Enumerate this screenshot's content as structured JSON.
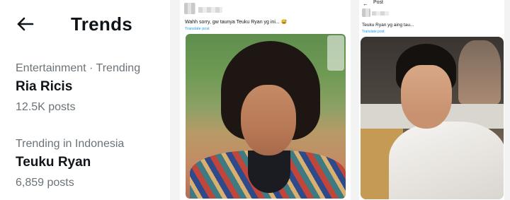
{
  "trends_panel": {
    "title": "Trends",
    "items": [
      {
        "context": "Entertainment · Trending",
        "name": "Ria Ricis",
        "count": "12.5K posts"
      },
      {
        "context": "Trending in Indonesia",
        "name": "Teuku Ryan",
        "count": "6,859 posts"
      }
    ]
  },
  "post_middle": {
    "text": "Wahh sorry, gw taunya Teuku Ryan yg ini... 😅",
    "translate_label": "Translate post",
    "image_description_icon": "portrait-photo-icon"
  },
  "post_right": {
    "header_label": "Post",
    "back_icon": "back-arrow-icon",
    "text": "Teuku Ryan yg aing tau...",
    "translate_label": "Translate post",
    "image_description_icon": "portrait-photo-icon"
  },
  "colors": {
    "text_primary": "#0f1419",
    "text_secondary": "#6b7378",
    "link": "#1d9bf0"
  }
}
